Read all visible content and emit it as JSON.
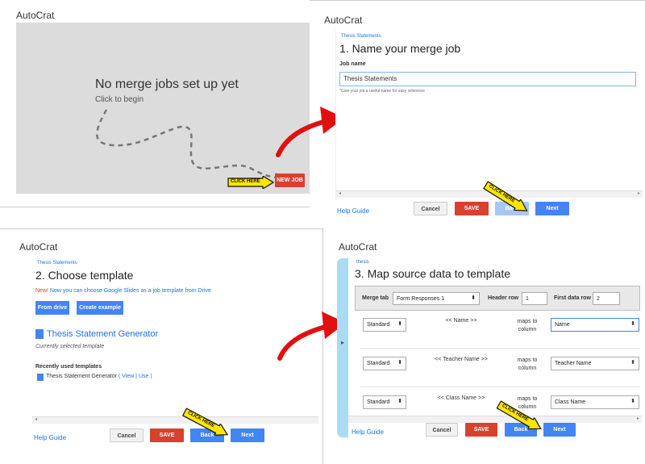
{
  "panel1": {
    "app_title": "AutoCrat",
    "empty_title": "No merge jobs set up yet",
    "empty_sub": "Click to begin",
    "click_here": "CLICK HERE",
    "new_job_btn": "NEW JOB"
  },
  "panel2": {
    "breadcrumb": "Thesis Statements",
    "step_title": "1. Name your merge job",
    "job_name_label": "Job name",
    "job_name_value": "Thesis Statements",
    "hint": "*Give your job a useful name for easy reference",
    "help": "Help Guide",
    "cancel": "Cancel",
    "save": "SAVE",
    "back": "Back",
    "next": "Next",
    "click_here": "CLICK HERE"
  },
  "panel3": {
    "app_title": "AutoCrat",
    "breadcrumb": "Thesis Statements",
    "step_title": "2. Choose template",
    "new_word": "New!",
    "new_text": " Now you can choose Google Slides as a job template from Drive",
    "from_drive": "From drive",
    "create_example": "Create example",
    "template_name": "Thesis Statement Generator",
    "template_sub": "Currently selected template",
    "recent_label": "Recently used templates",
    "recent_item": "Thesis Statement Generator",
    "view": "View",
    "use": "Use",
    "help": "Help Guide",
    "cancel": "Cancel",
    "save": "SAVE",
    "back": "Back",
    "next": "Next",
    "click_here": "CLICK HERE"
  },
  "panel4": {
    "app_title": "AutoCrat",
    "breadcrumb": "thesis",
    "step_title": "3. Map source data to template",
    "merge_tab_label": "Merge tab",
    "merge_tab_value": "Form Responses 1",
    "header_row_label": "Header row",
    "header_row_value": "1",
    "first_data_row_label": "First data row",
    "first_data_row_value": "2",
    "rows": [
      {
        "type": "Standard",
        "tag": "<< Name >>",
        "maps": "maps to column",
        "column": "Name"
      },
      {
        "type": "Standard",
        "tag": "<< Teacher Name >>",
        "maps": "maps to column",
        "column": "Teacher Name"
      },
      {
        "type": "Standard",
        "tag": "<< Class Name >>",
        "maps": "maps to column",
        "column": "Class Name"
      }
    ],
    "help": "Help Guide",
    "cancel": "Cancel",
    "save": "SAVE",
    "back": "Back",
    "next": "Next",
    "click_here": "CLICK HERE"
  },
  "colors": {
    "red": "#d9412f",
    "blue": "#4285f4",
    "light_blue": "#a8c6f6",
    "arrow_red": "#e01010",
    "sidebar_blue": "#a9dcf3",
    "click_here_yellow": "#ffe600"
  }
}
